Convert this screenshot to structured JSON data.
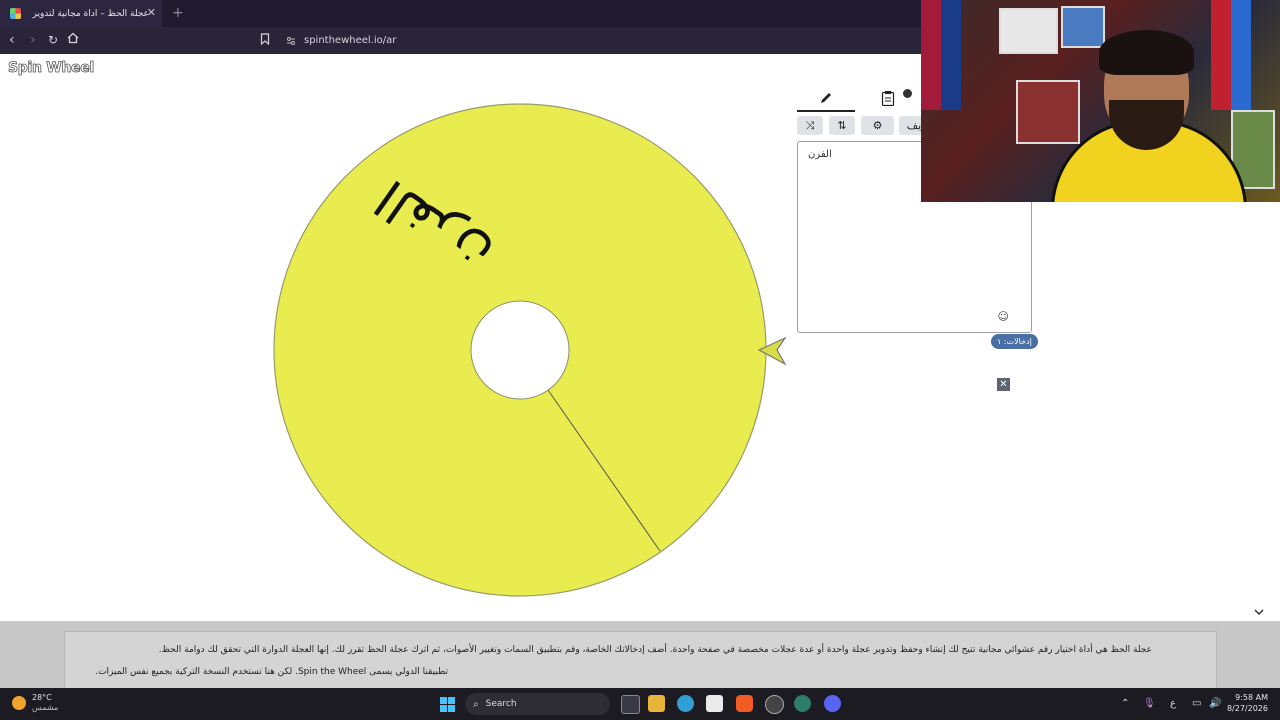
{
  "browser": {
    "tab_title": "عجلة الحظ – أداة مجانية لتدوير الـ",
    "tab_close": "✕",
    "new_tab": "+",
    "url": "spinthewheel.io/ar"
  },
  "logo": "Spin Wheel",
  "wheel": {
    "segment_label": "الفرن",
    "color": "#e8ec4e"
  },
  "panel": {
    "tab_edit_icon": "pencil-icon",
    "tab_results_icon": "clipboard-icon",
    "tool_shuffle": "⤨",
    "tool_sort": "⇅",
    "tool_settings": "⚙",
    "tool_add_label": "يف",
    "entries_text": "الفرن",
    "smiley": "☺",
    "entries_count": "إدخالات: ١",
    "close_label": "✕"
  },
  "info": {
    "line1": "عجلة الحظ هي أداة اختيار رقم عشوائي مجانية تتيح لك إنشاء وحفظ وتدوير عجلة واحدة أو عدة عجلات مخصصة في صفحة واحدة. أضف إدخالاتك الخاصة، وقم بتطبيق السمات وتغيير الأصوات، ثم اترك عجلة الحظ تقرر لك. إنها العجلة الدوارة التي تحقق لك دوامة الحظ.",
    "line2": "تطبيقنا الدولي يسمى Spin the Wheel. لكن هنا تستخدم النسخة التركية بجميع نفس الميزات."
  },
  "taskbar": {
    "weather_temp": "28°C",
    "weather_desc": "مشمس",
    "search_label": "Search",
    "lang": "ع",
    "time": "9:58 AM",
    "date": "8/27/2026"
  }
}
